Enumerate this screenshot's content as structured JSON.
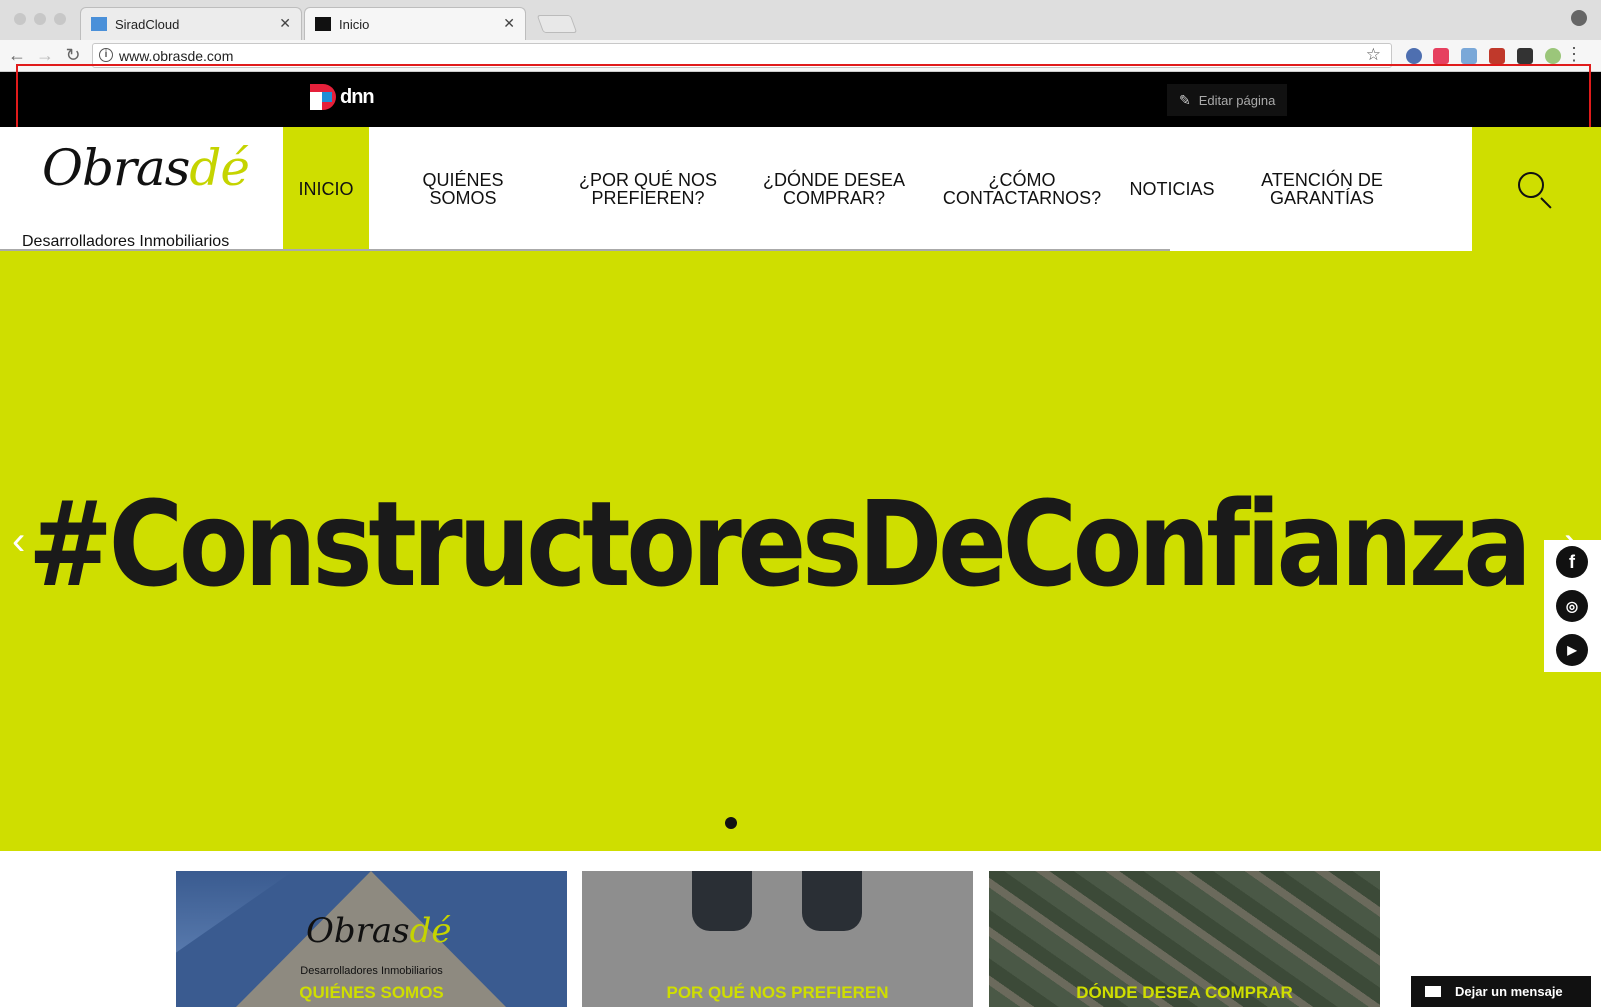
{
  "browser": {
    "tabs": [
      {
        "title": "SiradCloud",
        "active": false
      },
      {
        "title": "Inicio",
        "active": true
      }
    ],
    "url": "www.obrasde.com"
  },
  "dnn": {
    "logo_text": "DNN",
    "edit_label": "Editar página"
  },
  "site": {
    "logo_script": "Obras",
    "logo_accent": "dé",
    "logo_tagline": "Desarrolladores Inmobiliarios",
    "nav": [
      {
        "label": "INICIO",
        "active": true
      },
      {
        "label": "QUIÉNES SOMOS",
        "active": false
      },
      {
        "label": "¿POR QUÉ NOS PREFIEREN?",
        "active": false
      },
      {
        "label": "¿DÓNDE DESEA COMPRAR?",
        "active": false
      },
      {
        "label": "¿CÓMO CONTACTARNOS?",
        "active": false
      },
      {
        "label": "NOTICIAS",
        "active": false
      },
      {
        "label": "ATENCIÓN DE GARANTÍAS",
        "active": false
      }
    ],
    "accent_color": "#cfde00"
  },
  "hero": {
    "headline": "#ConstructoresDeConfianza",
    "slide_count": 1,
    "active_slide": 1
  },
  "social": [
    "facebook-icon",
    "instagram-icon",
    "youtube-icon"
  ],
  "cards": [
    {
      "label": "QUIÉNES SOMOS"
    },
    {
      "label": "POR QUÉ NOS PREFIEREN"
    },
    {
      "label": "DÓNDE DESEA COMPRAR"
    }
  ],
  "chat": {
    "label": "Dejar un mensaje"
  }
}
